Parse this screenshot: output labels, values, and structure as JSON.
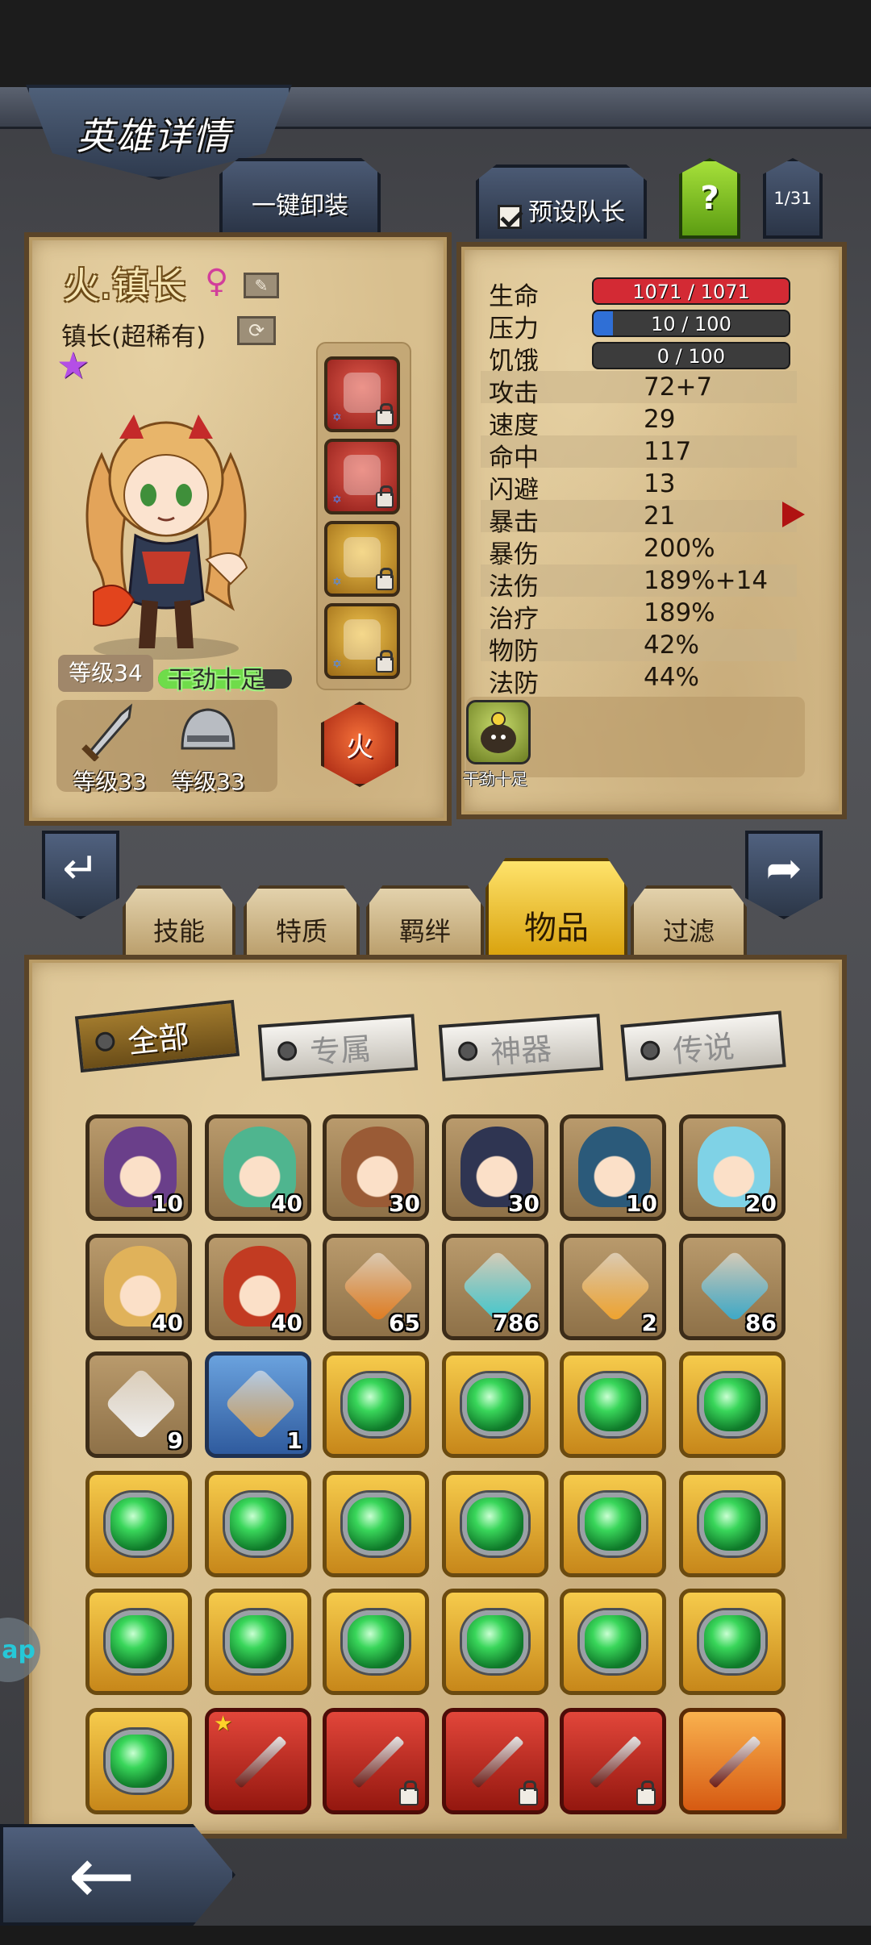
{
  "header": {
    "title": "英雄详情"
  },
  "top_buttons": {
    "unequip_all": "一键卸装",
    "preset_captain": "预设队长",
    "help": "?",
    "page": "1/31"
  },
  "hero": {
    "name": "火.镇长",
    "gender_symbol": "♀",
    "class": "镇长(超稀有)",
    "rarity_star": "★",
    "level": "等级34",
    "mood_label": "干劲十足",
    "mood_level": 0.75,
    "element": "火",
    "gear": [
      {
        "icon": "sword-icon",
        "label": "等级33"
      },
      {
        "icon": "helmet-icon",
        "label": "等级33"
      }
    ],
    "equip_slots": [
      {
        "icon": "dagger-icon",
        "color": "red",
        "locked": true
      },
      {
        "icon": "claw-icon",
        "color": "red",
        "locked": true
      },
      {
        "icon": "helmet-icon",
        "color": "gold",
        "locked": true
      },
      {
        "icon": "pouch-icon",
        "color": "gold",
        "locked": true
      }
    ]
  },
  "stats": {
    "bars": [
      {
        "label": "生命",
        "value": "1071 / 1071",
        "fill": 1.0,
        "color": "#d32a34"
      },
      {
        "label": "压力",
        "value": "10 / 100",
        "fill": 0.1,
        "color": "#2f6fd6"
      },
      {
        "label": "饥饿",
        "value": "0 / 100",
        "fill": 0.0,
        "color": "#888888"
      }
    ],
    "rows": [
      {
        "label": "攻击",
        "value": "72+7"
      },
      {
        "label": "速度",
        "value": "29"
      },
      {
        "label": "命中",
        "value": "117"
      },
      {
        "label": "闪避",
        "value": "13"
      },
      {
        "label": "暴击",
        "value": "21"
      },
      {
        "label": "暴伤",
        "value": "200%"
      },
      {
        "label": "法伤",
        "value": "189%+14"
      },
      {
        "label": "治疗",
        "value": "189%"
      },
      {
        "label": "物防",
        "value": "42%"
      },
      {
        "label": "法防",
        "value": "44%"
      }
    ],
    "trait_label": "干劲十足"
  },
  "tabs": [
    {
      "label": "技能",
      "active": false
    },
    {
      "label": "特质",
      "active": false
    },
    {
      "label": "羁绊",
      "active": false
    },
    {
      "label": "物品",
      "active": true
    },
    {
      "label": "过滤",
      "active": false
    }
  ],
  "filters": [
    {
      "label": "全部",
      "active": true
    },
    {
      "label": "专属",
      "active": false
    },
    {
      "label": "神器",
      "active": false
    },
    {
      "label": "传说",
      "active": false
    }
  ],
  "inventory": [
    {
      "kind": "hero",
      "icon": "hero-portrait-icon",
      "count": "10",
      "frame": "plain",
      "tint": "#6a3f8a"
    },
    {
      "kind": "hero",
      "icon": "hero-portrait-icon",
      "count": "40",
      "frame": "plain",
      "tint": "#4fb58f"
    },
    {
      "kind": "hero",
      "icon": "hero-portrait-icon",
      "count": "30",
      "frame": "plain",
      "tint": "#9a5b36"
    },
    {
      "kind": "hero",
      "icon": "hero-portrait-icon",
      "count": "30",
      "frame": "plain",
      "tint": "#2f3552"
    },
    {
      "kind": "hero",
      "icon": "hero-portrait-icon",
      "count": "10",
      "frame": "plain",
      "tint": "#2b5a7a"
    },
    {
      "kind": "hero",
      "icon": "hero-portrait-icon",
      "count": "20",
      "frame": "plain",
      "tint": "#7fd2e6"
    },
    {
      "kind": "hero",
      "icon": "hero-portrait-icon",
      "count": "40",
      "frame": "plain",
      "tint": "#e0b25a"
    },
    {
      "kind": "hero",
      "icon": "hero-portrait-icon",
      "count": "40",
      "frame": "plain",
      "tint": "#c23b22"
    },
    {
      "kind": "item",
      "icon": "amber-gem-icon",
      "count": "65",
      "frame": "plain",
      "tint": "#e07a1c"
    },
    {
      "kind": "item",
      "icon": "cyan-rune-icon",
      "count": "786",
      "frame": "plain",
      "tint": "#3cc8cf"
    },
    {
      "kind": "item",
      "icon": "feather-gold-icon",
      "count": "2",
      "frame": "plain",
      "tint": "#f0a22a"
    },
    {
      "kind": "item",
      "icon": "potion-icon",
      "count": "86",
      "frame": "plain",
      "tint": "#38a8c8"
    },
    {
      "kind": "item",
      "icon": "feather-icon",
      "count": "9",
      "frame": "plain",
      "tint": "#f2f2f2"
    },
    {
      "kind": "item",
      "icon": "chest-icon",
      "count": "1",
      "frame": "blue",
      "tint": "#c89a55"
    },
    {
      "kind": "gem",
      "icon": "green-gem-icon",
      "count": "",
      "frame": "gold"
    },
    {
      "kind": "gem",
      "icon": "green-gem-icon",
      "count": "",
      "frame": "gold"
    },
    {
      "kind": "gem",
      "icon": "green-gem-icon",
      "count": "",
      "frame": "gold"
    },
    {
      "kind": "gem",
      "icon": "green-gem-icon",
      "count": "",
      "frame": "gold"
    },
    {
      "kind": "gem",
      "icon": "green-gem-icon",
      "count": "",
      "frame": "gold"
    },
    {
      "kind": "gem",
      "icon": "green-gem-icon",
      "count": "",
      "frame": "gold"
    },
    {
      "kind": "gem",
      "icon": "green-gem-icon",
      "count": "",
      "frame": "gold"
    },
    {
      "kind": "gem",
      "icon": "green-gem-icon",
      "count": "",
      "frame": "gold"
    },
    {
      "kind": "gem",
      "icon": "green-gem-icon",
      "count": "",
      "frame": "gold"
    },
    {
      "kind": "gem",
      "icon": "green-gem-icon",
      "count": "",
      "frame": "gold"
    },
    {
      "kind": "gem",
      "icon": "green-gem-icon",
      "count": "",
      "frame": "gold"
    },
    {
      "kind": "gem",
      "icon": "green-gem-icon",
      "count": "",
      "frame": "gold"
    },
    {
      "kind": "gem",
      "icon": "green-gem-icon",
      "count": "",
      "frame": "gold"
    },
    {
      "kind": "gem",
      "icon": "green-gem-icon",
      "count": "",
      "frame": "gold"
    },
    {
      "kind": "gem",
      "icon": "green-gem-icon",
      "count": "",
      "frame": "gold"
    },
    {
      "kind": "gem",
      "icon": "green-gem-icon",
      "count": "",
      "frame": "gold"
    },
    {
      "kind": "gem",
      "icon": "green-gem-icon",
      "count": "",
      "frame": "gold"
    },
    {
      "kind": "weapon",
      "icon": "axe-icon",
      "count": "",
      "frame": "red",
      "starred": true
    },
    {
      "kind": "weapon",
      "icon": "red-blade-icon",
      "count": "",
      "frame": "red",
      "locked": true
    },
    {
      "kind": "weapon",
      "icon": "double-axe-icon",
      "count": "",
      "frame": "red",
      "locked": true
    },
    {
      "kind": "weapon",
      "icon": "lightning-spear-icon",
      "count": "",
      "frame": "red",
      "locked": true
    },
    {
      "kind": "weapon",
      "icon": "crossed-swords-icon",
      "count": "",
      "frame": "orange"
    }
  ],
  "navigation": {
    "prev": "↵",
    "next": "➦",
    "back": "←"
  },
  "side_bubble": "ap"
}
